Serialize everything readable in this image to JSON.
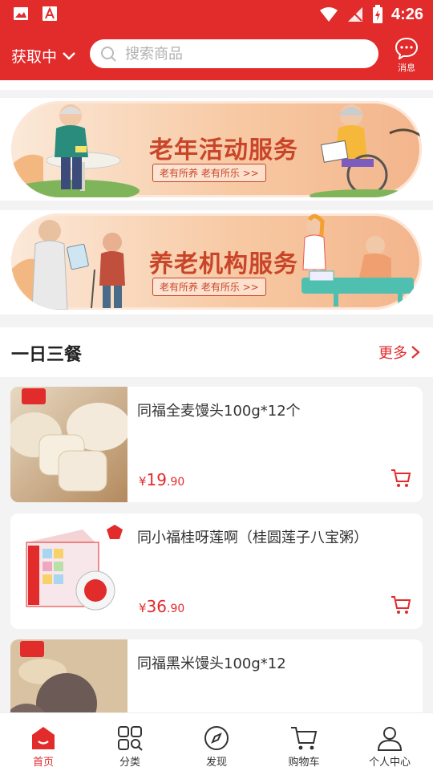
{
  "status_bar": {
    "time": "4:26"
  },
  "header": {
    "location_label": "获取中",
    "search_placeholder": "搜索商品",
    "message_label": "消息"
  },
  "banners": [
    {
      "title": "老年活动服务",
      "subtitle": "老有所养 老有所乐 >>"
    },
    {
      "title": "养老机构服务",
      "subtitle": "老有所养 老有所乐 >>"
    }
  ],
  "section": {
    "title": "一日三餐",
    "more_label": "更多"
  },
  "products": [
    {
      "name": "同福全麦馒头100g*12个",
      "price_symbol": "¥",
      "price_int": "19",
      "price_dec": ".90"
    },
    {
      "name": "同小福桂呀莲啊（桂圆莲子八宝粥）",
      "price_symbol": "¥",
      "price_int": "36",
      "price_dec": ".90"
    },
    {
      "name": "同福黑米馒头100g*12"
    }
  ],
  "tabs": [
    {
      "label": "首页",
      "icon": "home-icon"
    },
    {
      "label": "分类",
      "icon": "category-icon"
    },
    {
      "label": "发现",
      "icon": "compass-icon"
    },
    {
      "label": "购物车",
      "icon": "cart-icon"
    },
    {
      "label": "个人中心",
      "icon": "user-icon"
    }
  ],
  "colors": {
    "brand": "#e22b2b",
    "banner_text": "#c9452a"
  }
}
